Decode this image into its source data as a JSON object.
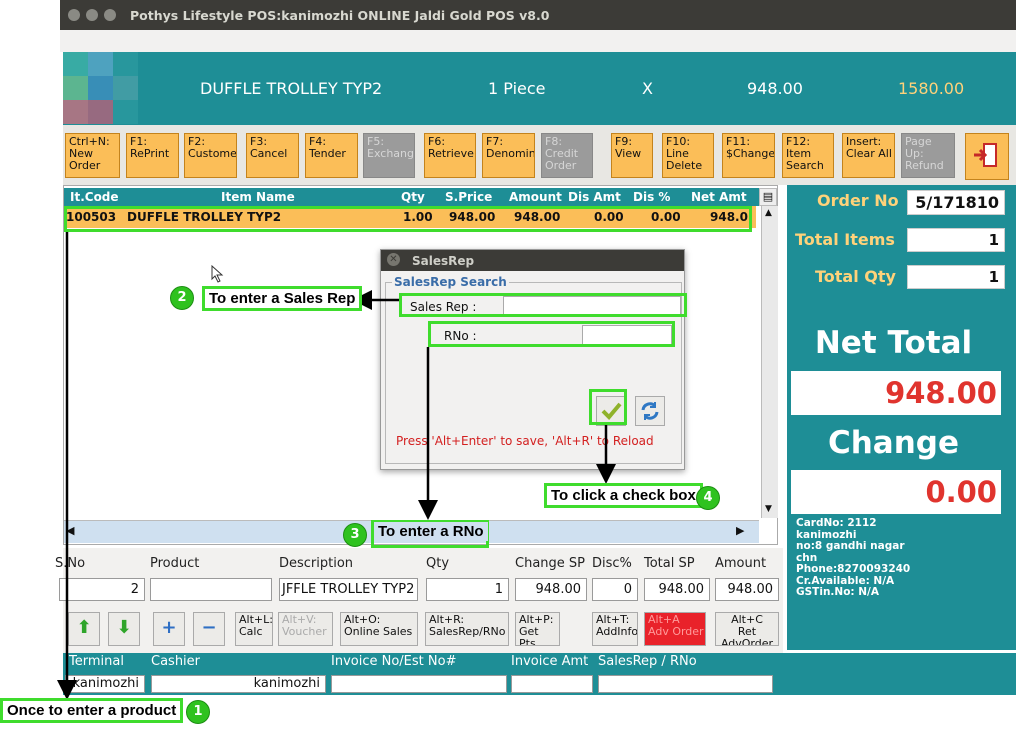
{
  "window": {
    "title": "Pothys Lifestyle POS:kanimozhi    ONLINE Jaldi Gold POS v8.0"
  },
  "top_display": {
    "item": "DUFFLE TROLLEY TYP2",
    "qty": "1 Piece",
    "op": "X",
    "rate": "948.00",
    "total": "1580.00"
  },
  "toolbar": [
    {
      "label": "Ctrl+N:\nNew\nOrder",
      "enabled": true
    },
    {
      "label": "F1:\nRePrint",
      "enabled": true
    },
    {
      "label": "F2:\nCustome",
      "enabled": true
    },
    {
      "label": "F3:\nCancel",
      "enabled": true
    },
    {
      "label": "F4:\nTender",
      "enabled": true
    },
    {
      "label": "F5:\nExchang",
      "enabled": false
    },
    {
      "label": "F6:\nRetrieve",
      "enabled": true
    },
    {
      "label": "F7:\nDenomin",
      "enabled": true
    },
    {
      "label": "F8:\nCredit\nOrder",
      "enabled": false
    },
    {
      "label": "F9:\nView",
      "enabled": true
    },
    {
      "label": "F10:\nLine\nDelete",
      "enabled": true
    },
    {
      "label": "F11:\n$Change",
      "enabled": true
    },
    {
      "label": "F12:\nItem\nSearch",
      "enabled": true
    },
    {
      "label": "Insert:\nClear All",
      "enabled": true
    },
    {
      "label": "Page\nUp:\nRefund",
      "enabled": false
    }
  ],
  "grid": {
    "headers": [
      "It.Code",
      "Item Name",
      "Qty",
      "S.Price",
      "Amount",
      "Dis Amt",
      "Dis %",
      "Net Amt"
    ],
    "rows": [
      [
        "100503",
        "DUFFLE TROLLEY TYP2",
        "1.00",
        "948.00",
        "948.00",
        "0.00",
        "0.00",
        "948.0"
      ]
    ]
  },
  "summary": {
    "order_no_label": "Order No",
    "order_no": "5/171810",
    "total_items_label": "Total Items",
    "total_items": "1",
    "total_qty_label": "Total Qty",
    "total_qty": "1",
    "net_total_label": "Net Total",
    "net_total": "948.00",
    "change_label": "Change",
    "change": "0.00",
    "customer": "CardNo: 2112\nkanimozhi\nno:8 gandhi nagar\nchn\nPhone:8270093240\nCr.Available: N/A\nGSTin.No: N/A"
  },
  "detail": {
    "labels": [
      "S.No",
      "Product",
      "Description",
      "Qty",
      "Change SP",
      "Disc%",
      "Total SP",
      "Amount"
    ],
    "values": [
      "2",
      "",
      "JFFLE TROLLEY TYP2",
      "1",
      "948.00",
      "0",
      "948.00",
      "948.00"
    ],
    "buttons": [
      {
        "label": "Alt+L:\nCalc",
        "state": "normal"
      },
      {
        "label": "Alt+V:\nVoucher",
        "state": "disabled"
      },
      {
        "label": "Alt+O:\nOnline Sales",
        "state": "normal"
      },
      {
        "label": "Alt+R:\nSalesRep/RNo",
        "state": "normal"
      },
      {
        "label": "Alt+P:\nGet\nPts",
        "state": "normal"
      },
      {
        "label": "Alt+T:\nAddInfo",
        "state": "normal"
      },
      {
        "label": "Alt+A\nAdv Order",
        "state": "red"
      },
      {
        "label": "Alt+C\nRet\nAdvOrder",
        "state": "normal"
      }
    ]
  },
  "status": {
    "labels": [
      "Terminal",
      "Cashier",
      "Invoice No/Est No#",
      "Invoice Amt",
      "SalesRep / RNo"
    ],
    "terminal": "kanimozhi",
    "cashier": "kanimozhi"
  },
  "dialog": {
    "title": "SalesRep",
    "group": "SalesRep Search",
    "salesrep_label": "Sales Rep :",
    "salesrep_value": "",
    "rno_label": "RNo :",
    "rno_value": "",
    "hint": "Press 'Alt+Enter' to save, 'Alt+R' to Reload"
  },
  "annotations": {
    "n1": "Once to enter a product",
    "n2": "To enter a Sales Rep",
    "n3": "To enter a RNo",
    "n4": "To click a check box",
    "b1": "1",
    "b2": "2",
    "b3": "3",
    "b4": "4"
  },
  "colors": {
    "teal": "#1e8e96",
    "orange": "#fbbe58",
    "highlight": "#3fdc2d",
    "red": "#e0342e"
  }
}
